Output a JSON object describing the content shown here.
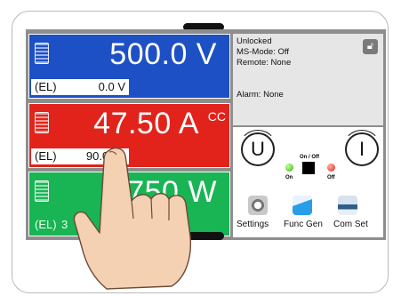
{
  "voltage": {
    "value": "500.0 V",
    "source": "(EL)",
    "set_value": "0.0 V"
  },
  "current": {
    "value": "47.50 A",
    "mode": "CC",
    "source": "(EL)",
    "set_value": "90.00 A"
  },
  "power": {
    "value_visible": "2 750 W",
    "source": "(EL)",
    "set_value_visible": "3"
  },
  "status": {
    "lines": [
      "Unlocked",
      "MS-Mode: Off",
      "Remote: None"
    ],
    "alarm": "Alarm: None"
  },
  "controls": {
    "knob_u": "U",
    "knob_i": "I",
    "onoff_label": "On / Off",
    "led_on_label": "On",
    "led_off_label": "Off"
  },
  "tools": {
    "settings": "Settings",
    "funcgen": "Func Gen",
    "comset": "Com Set"
  },
  "colors": {
    "voltage_panel": "#1e50c5",
    "current_panel": "#e2231b",
    "power_panel": "#19b454",
    "status_bg": "#e6e6e6"
  }
}
